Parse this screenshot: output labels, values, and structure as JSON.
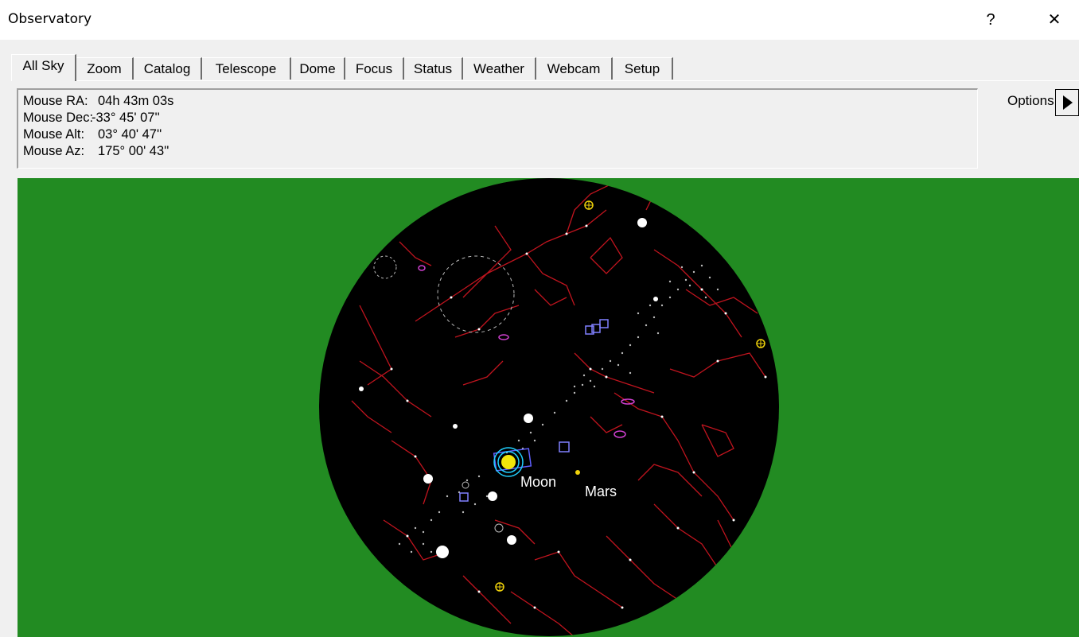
{
  "window": {
    "title": "Observatory",
    "help_glyph": "?",
    "close_glyph": "✕"
  },
  "tabs": [
    {
      "label": "All Sky",
      "active": true
    },
    {
      "label": "Zoom"
    },
    {
      "label": "Catalog"
    },
    {
      "label": "Telescope"
    },
    {
      "label": "Dome"
    },
    {
      "label": "Focus"
    },
    {
      "label": "Status"
    },
    {
      "label": "Weather"
    },
    {
      "label": "Webcam"
    },
    {
      "label": "Setup"
    }
  ],
  "mouse_info": {
    "ra_label": "Mouse RA:",
    "ra_value": "04h 43m 03s",
    "dec_label": "Mouse Dec:",
    "dec_value": "-33° 45' 07''",
    "alt_label": "Mouse Alt:",
    "alt_value": "03° 40' 47''",
    "az_label": "Mouse Az:",
    "az_value": "175° 00' 43''"
  },
  "options": {
    "label": "Options",
    "arrow_icon": "play-right-icon"
  },
  "sky": {
    "labels": {
      "moon": "Moon",
      "mars": "Mars"
    },
    "colors": {
      "ground": "#228b22",
      "sky": "#000000",
      "constellation_lines": "#c0141e",
      "stars": "#ffffff",
      "moon": "#f5e60a",
      "planet_marker": "#f0d20a",
      "galaxy": "#d040d0",
      "cluster": "#8080ff",
      "telescope_ring": "#20d0ff"
    }
  }
}
